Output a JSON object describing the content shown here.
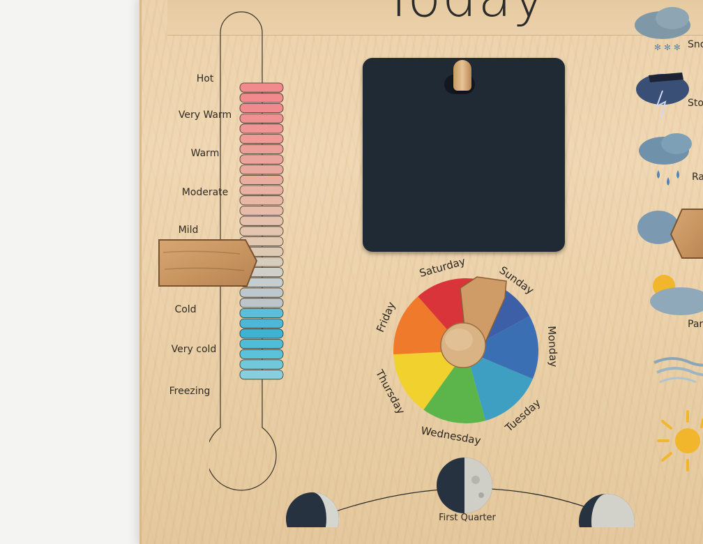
{
  "board": {
    "title": "Today"
  },
  "thermometer": {
    "labels": [
      "Hot",
      "Very Warm",
      "Warm",
      "Moderate",
      "Mild",
      "Cold",
      "Very cold",
      "Freezing"
    ],
    "segment_colors": [
      "#f08a8c",
      "#f08a8c",
      "#f08a8c",
      "#ef9092",
      "#ef9595",
      "#ee9a97",
      "#ec9f99",
      "#eba49c",
      "#eaa99e",
      "#e9aea0",
      "#e8b3a3",
      "#e7b8a6",
      "#e6bda9",
      "#e5c2ad",
      "#e4c5af",
      "#e2c7b1",
      "#dec9b5",
      "#d7cdbd",
      "#cfcfc8",
      "#c4cdd0",
      "#bcc8ce",
      "#bdc5cb",
      "#5bbfd9",
      "#4ab8d6",
      "#3eb2d3",
      "#4fbcd8",
      "#5cc2da",
      "#71c8db",
      "#86cfde"
    ]
  },
  "day_wheel": {
    "days": [
      "Sunday",
      "Monday",
      "Tuesday",
      "Wednesday",
      "Thursday",
      "Friday",
      "Saturday"
    ],
    "colors": [
      "#3d5fa8",
      "#3b6fb3",
      "#3f9fc2",
      "#5bb54b",
      "#f0d12e",
      "#ef7a2c",
      "#d9343a"
    ],
    "selected_day": "Sunday"
  },
  "weather": {
    "labels": [
      "Sno",
      "Sto",
      "Ra",
      "Par"
    ],
    "icons": [
      "snow-cloud-icon",
      "storm-cloud-icon",
      "rain-cloud-icon",
      "cloud-icon",
      "partly-cloudy-icon",
      "wind-icon",
      "sun-icon"
    ]
  },
  "moon": {
    "phase_label": "First Quarter"
  }
}
